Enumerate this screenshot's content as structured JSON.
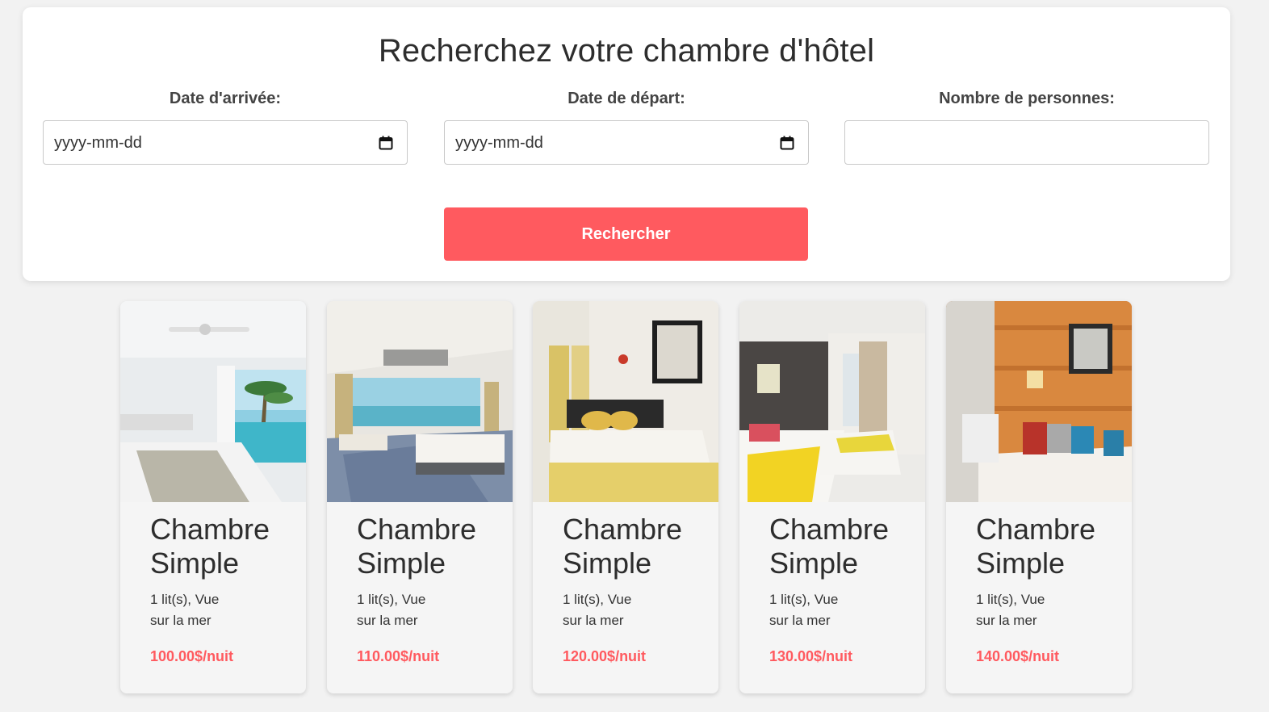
{
  "search": {
    "title": "Recherchez votre chambre d'hôtel",
    "arrival_label": "Date d'arrivée:",
    "arrival_value": "yyyy-mm-dd",
    "departure_label": "Date de départ:",
    "departure_value": "yyyy-mm-dd",
    "guests_label": "Nombre de personnes:",
    "guests_value": "",
    "button_label": "Rechercher",
    "accent_color": "#ff5a5f"
  },
  "rooms": [
    {
      "title": "Chambre Simple",
      "description": "1 lit(s), Vue sur la mer",
      "price": "100.00$/nuit",
      "photo": "bright-seaview-room-photo"
    },
    {
      "title": "Chambre Simple",
      "description": "1 lit(s), Vue sur la mer",
      "price": "110.00$/nuit",
      "photo": "luxury-suite-seaview-photo"
    },
    {
      "title": "Chambre Simple",
      "description": "1 lit(s), Vue sur la mer",
      "price": "120.00$/nuit",
      "photo": "classic-room-yellow-bedding-photo"
    },
    {
      "title": "Chambre Simple",
      "description": "1 lit(s), Vue sur la mer",
      "price": "130.00$/nuit",
      "photo": "twin-beds-yellow-throw-photo"
    },
    {
      "title": "Chambre Simple",
      "description": "1 lit(s), Vue sur la mer",
      "price": "140.00$/nuit",
      "photo": "wood-panel-room-cushions-photo"
    }
  ]
}
